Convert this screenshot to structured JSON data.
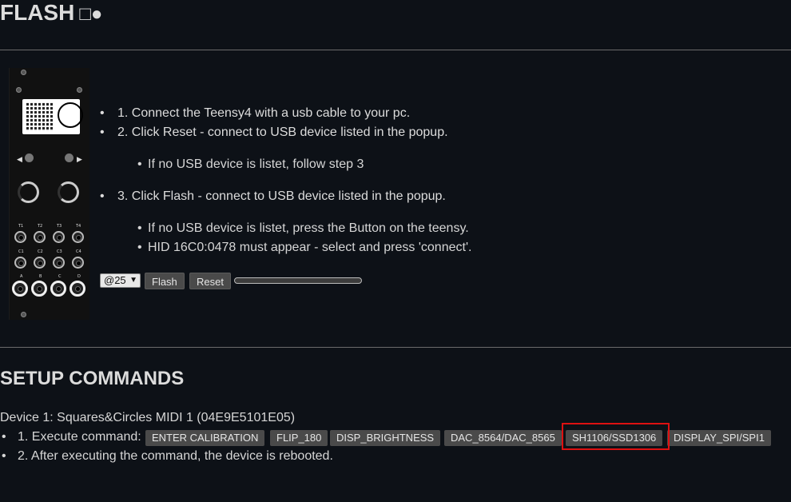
{
  "header": {
    "title": "FLASH",
    "icons": "□●"
  },
  "instructions": {
    "step1": "1. Connect the Teensy4 with a usb cable to your pc.",
    "step2": "2. Click Reset - connect to USB device listed in the popup.",
    "step2_sub": "If no USB device is listet, follow step 3",
    "step3": "3. Click Flash - connect to USB device listed in the popup.",
    "step3_sub1": "If no USB device is listet, press the Button on the teensy.",
    "step3_sub2": "HID 16C0:0478 must appear - select and press 'connect'."
  },
  "controls": {
    "select_value": "@25",
    "flash_label": "Flash",
    "reset_label": "Reset",
    "progress": 0
  },
  "module": {
    "row1_labels": [
      "T1",
      "T2",
      "T3",
      "T4"
    ],
    "row2_labels": [
      "C1",
      "C2",
      "C3",
      "C4"
    ],
    "row3_labels": [
      "A",
      "B",
      "C",
      "D"
    ]
  },
  "setup": {
    "title": "SETUP COMMANDS",
    "device": "Device 1: Squares&Circles MIDI 1 (04E9E5101E05)",
    "execute_label": "1. Execute command:",
    "commands": [
      "ENTER CALIBRATION",
      "FLIP_180",
      "DISP_BRIGHTNESS",
      "DAC_8564/DAC_8565",
      "SH1106/SSD1306",
      "DISPLAY_SPI/SPI1"
    ],
    "note": "2. After executing the command, the device is rebooted."
  },
  "colors": {
    "background": "#0d1117",
    "button": "#4a4a4a",
    "highlight": "#dd1111"
  }
}
